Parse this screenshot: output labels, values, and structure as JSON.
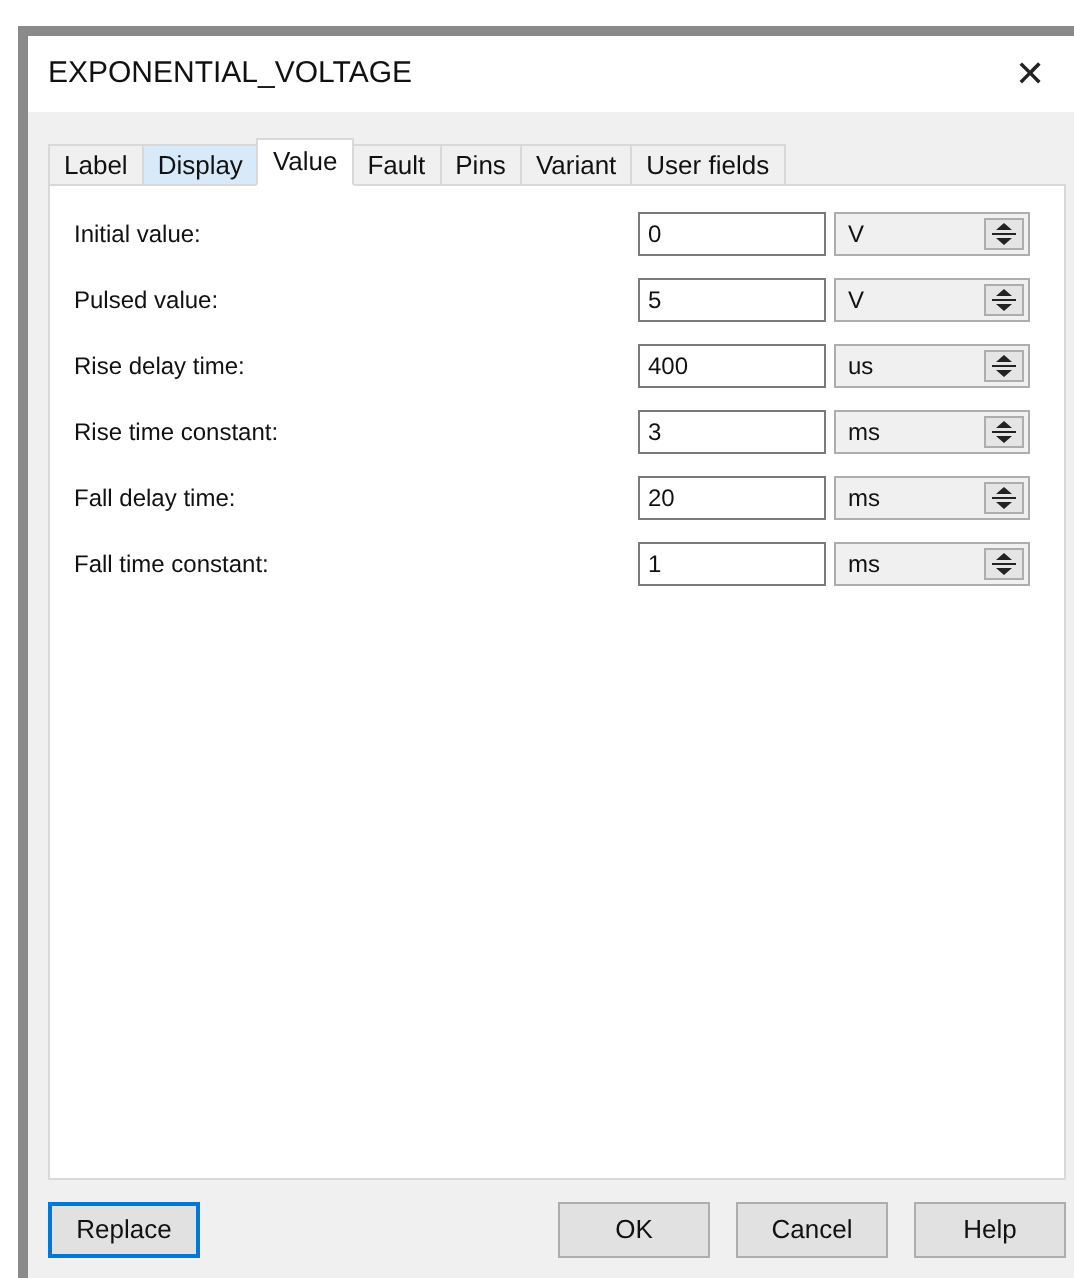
{
  "window": {
    "title": "EXPONENTIAL_VOLTAGE",
    "close": "✕"
  },
  "tabs": [
    {
      "label": "Label",
      "selected": false,
      "hovered": false
    },
    {
      "label": "Display",
      "selected": false,
      "hovered": true
    },
    {
      "label": "Value",
      "selected": true,
      "hovered": false
    },
    {
      "label": "Fault",
      "selected": false,
      "hovered": false
    },
    {
      "label": "Pins",
      "selected": false,
      "hovered": false
    },
    {
      "label": "Variant",
      "selected": false,
      "hovered": false
    },
    {
      "label": "User fields",
      "selected": false,
      "hovered": false
    }
  ],
  "fields": [
    {
      "label": "Initial value:",
      "value": "0",
      "unit": "V"
    },
    {
      "label": "Pulsed value:",
      "value": "5",
      "unit": "V"
    },
    {
      "label": "Rise delay time:",
      "value": "400",
      "unit": "us"
    },
    {
      "label": "Rise time constant:",
      "value": "3",
      "unit": "ms"
    },
    {
      "label": "Fall delay time:",
      "value": "20",
      "unit": "ms"
    },
    {
      "label": "Fall time constant:",
      "value": "1",
      "unit": "ms"
    }
  ],
  "buttons": [
    {
      "label": "Replace",
      "focused": true
    },
    {
      "label": "OK",
      "focused": false
    },
    {
      "label": "Cancel",
      "focused": false
    },
    {
      "label": "Help",
      "focused": false
    }
  ]
}
